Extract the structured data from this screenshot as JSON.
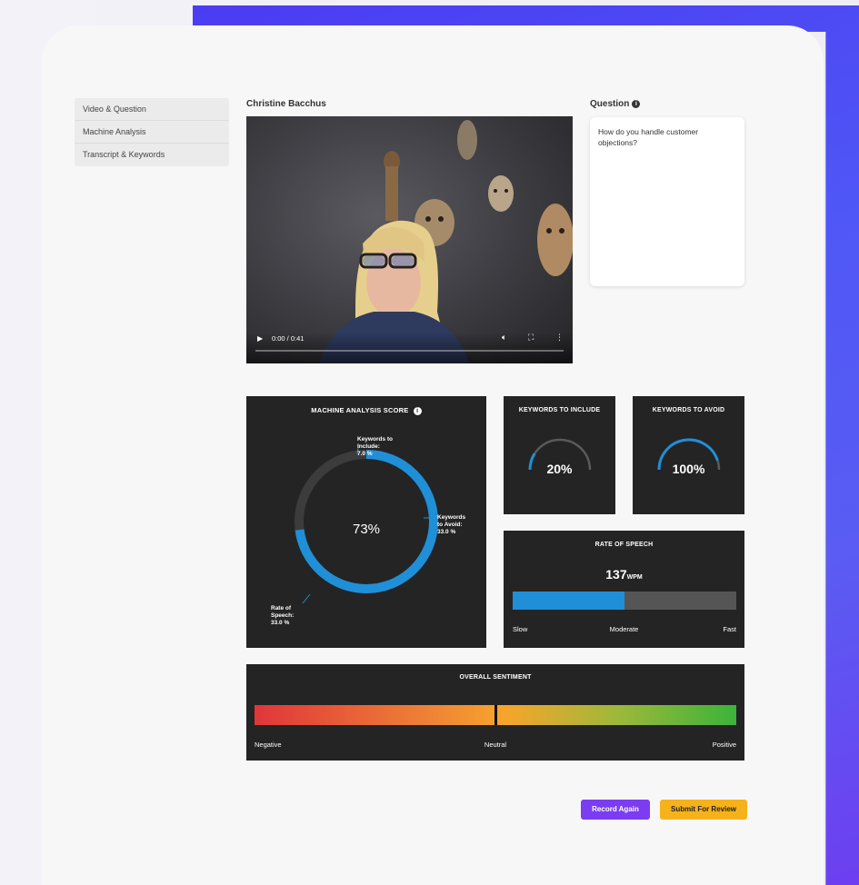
{
  "sidebar": {
    "items": [
      {
        "label": "Video & Question"
      },
      {
        "label": "Machine Analysis"
      },
      {
        "label": "Transcript & Keywords"
      }
    ]
  },
  "video": {
    "candidate_name": "Christine Bacchus",
    "time": "0:00 / 0:41",
    "icons": [
      "play-icon",
      "volume-icon",
      "fullscreen-icon",
      "more-options-icon"
    ]
  },
  "question": {
    "label": "Question",
    "text": "How do you handle customer objections?"
  },
  "machine_analysis": {
    "title": "MACHINE ANALYSIS SCORE",
    "score": "73%",
    "score_value": 73,
    "segments": [
      {
        "label": "Keywords to Include:",
        "value": "7.0 %"
      },
      {
        "label": "Keywords to Avoid:",
        "value": "33.0 %"
      },
      {
        "label": "Rate of Speech:",
        "value": "33.0 %"
      }
    ]
  },
  "keywords_include": {
    "title": "KEYWORDS TO INCLUDE",
    "value": "20%",
    "level": 0.2
  },
  "keywords_avoid": {
    "title": "KEYWORDS TO AVOID",
    "value": "100%",
    "level": 1.0
  },
  "rate_of_speech": {
    "title": "RATE OF SPEECH",
    "value": "137",
    "unit": "WPM",
    "level": 0.5,
    "scale": [
      "Slow",
      "Moderate",
      "Fast"
    ]
  },
  "sentiment": {
    "title": "OVERALL SENTIMENT",
    "level": 0.5,
    "scale": [
      "Negative",
      "Neutral",
      "Positive"
    ]
  },
  "buttons": {
    "record_again": "Record Again",
    "submit": "Submit For Review"
  },
  "colors": {
    "accent_blue": "#1f8fd8",
    "record_btn": "#7b3cf2",
    "submit_btn": "#f5b21a",
    "panel_bg": "#242424"
  }
}
